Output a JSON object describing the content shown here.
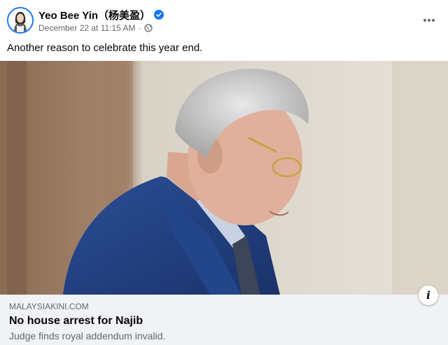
{
  "post": {
    "author": "Yeo Bee Yin（杨美盈）",
    "date": "December 22 at 11:15 AM",
    "separator": "·",
    "text": "Another reason to celebrate this year end."
  },
  "link_preview": {
    "domain": "MALAYSIAKINI.COM",
    "title": "No house arrest for Najib",
    "description": "Judge finds royal addendum invalid."
  },
  "icons": {
    "verified": "verified-badge-icon",
    "audience": "globe-icon",
    "more": "more-options-icon",
    "info": "info-icon"
  },
  "colors": {
    "accent": "#1877f2",
    "secondary_text": "#65676b",
    "preview_bg": "#f0f2f5"
  }
}
